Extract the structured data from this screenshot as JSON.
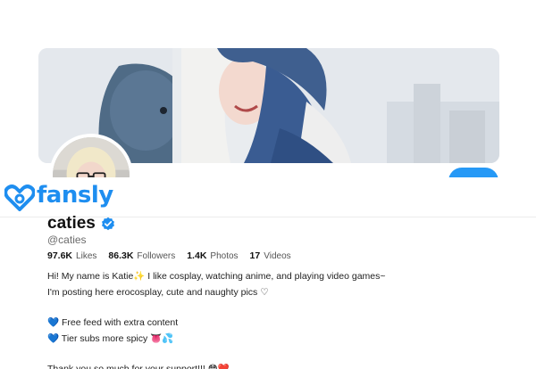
{
  "brand": {
    "name": "fansly",
    "color": "#1e8ef0"
  },
  "profile": {
    "display_name": "caties",
    "handle": "@caties",
    "verified_icon": "verified-check-icon",
    "follow_button_color": "#2699f6"
  },
  "stats": [
    {
      "value": "97.6K",
      "label": "Likes"
    },
    {
      "value": "86.3K",
      "label": "Followers"
    },
    {
      "value": "1.4K",
      "label": "Photos"
    },
    {
      "value": "17",
      "label": "Videos"
    }
  ],
  "bio": {
    "line1": "Hi! My name is Katie✨ I like cosplay, watching anime, and playing video games~",
    "line2": "I'm posting here erocosplay, cute and naughty pics ♡",
    "line3": "💙 Free feed with extra content",
    "line4": "💙 Tier subs more spicy 👅💦",
    "line5": "Thank you so much for your support!!! 😳❤️"
  }
}
